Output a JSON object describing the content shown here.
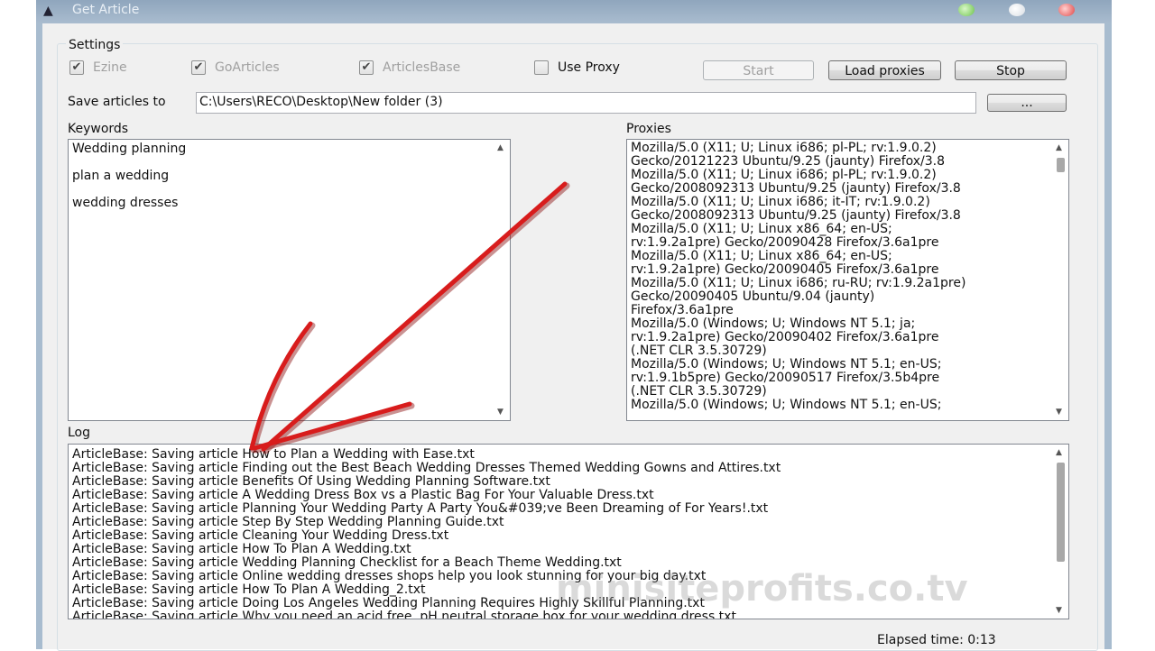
{
  "window": {
    "title": "Get Article"
  },
  "settings": {
    "group_label": "Settings",
    "checkboxes": [
      {
        "label": "Ezine",
        "checked": true,
        "enabled": false
      },
      {
        "label": "GoArticles",
        "checked": true,
        "enabled": false
      },
      {
        "label": "ArticlesBase",
        "checked": true,
        "enabled": false
      },
      {
        "label": "Use Proxy",
        "checked": false,
        "enabled": true
      }
    ],
    "buttons": {
      "start": "Start",
      "load_proxies": "Load proxies",
      "stop": "Stop",
      "browse": "..."
    },
    "save_label": "Save articles to",
    "save_path": "C:\\Users\\RECO\\Desktop\\New folder (3)"
  },
  "keywords": {
    "label": "Keywords",
    "items": [
      "Wedding planning",
      "plan a wedding",
      "wedding dresses"
    ]
  },
  "proxies": {
    "label": "Proxies",
    "lines": [
      "Mozilla/5.0 (X11; U; Linux i686; pl-PL; rv:1.9.0.2)",
      "Gecko/20121223 Ubuntu/9.25 (jaunty) Firefox/3.8",
      "Mozilla/5.0 (X11; U; Linux i686; pl-PL; rv:1.9.0.2)",
      "Gecko/2008092313 Ubuntu/9.25 (jaunty) Firefox/3.8",
      "Mozilla/5.0 (X11; U; Linux i686; it-IT; rv:1.9.0.2)",
      "Gecko/2008092313 Ubuntu/9.25 (jaunty) Firefox/3.8",
      "Mozilla/5.0 (X11; U; Linux x86_64; en-US;",
      "rv:1.9.2a1pre) Gecko/20090428 Firefox/3.6a1pre",
      "Mozilla/5.0 (X11; U; Linux x86_64; en-US;",
      "rv:1.9.2a1pre) Gecko/20090405 Firefox/3.6a1pre",
      "Mozilla/5.0 (X11; U; Linux i686; ru-RU; rv:1.9.2a1pre)",
      "Gecko/20090405 Ubuntu/9.04 (jaunty)",
      "Firefox/3.6a1pre",
      "Mozilla/5.0 (Windows; U; Windows NT 5.1; ja;",
      "rv:1.9.2a1pre) Gecko/20090402 Firefox/3.6a1pre",
      "(.NET CLR 3.5.30729)",
      "Mozilla/5.0 (Windows; U; Windows NT 5.1; en-US;",
      "rv:1.9.1b5pre) Gecko/20090517 Firefox/3.5b4pre",
      "(.NET CLR 3.5.30729)",
      "Mozilla/5.0 (Windows; U; Windows NT 5.1; en-US;"
    ]
  },
  "log": {
    "label": "Log",
    "lines": [
      "ArticleBase: Saving article How to Plan a Wedding with Ease.txt",
      "ArticleBase: Saving article Finding out the Best Beach Wedding Dresses Themed Wedding Gowns and Attires.txt",
      "ArticleBase: Saving article Benefits Of Using Wedding Planning Software.txt",
      "ArticleBase: Saving article A Wedding Dress Box vs a Plastic Bag For Your Valuable Dress.txt",
      "ArticleBase: Saving article Planning Your Wedding Party A Party You&#039;ve Been Dreaming of For Years!.txt",
      "ArticleBase: Saving article Step By Step Wedding Planning Guide.txt",
      "ArticleBase: Saving article Cleaning Your Wedding Dress.txt",
      "ArticleBase: Saving article How To Plan A Wedding.txt",
      "ArticleBase: Saving article Wedding Planning Checklist for a Beach Theme Wedding.txt",
      "ArticleBase: Saving article Online wedding dresses shops help you look stunning for your big day.txt",
      "ArticleBase: Saving article How To Plan A Wedding_2.txt",
      "ArticleBase: Saving article Doing Los Angeles Wedding Planning Requires Highly Skillful Planning.txt",
      "ArticleBase: Saving article Why you need an acid free, pH neutral storage box for your wedding dress.txt"
    ]
  },
  "status": {
    "elapsed": "Elapsed time: 0:13"
  },
  "watermark": "minisiteprofits.co.tv",
  "colors": {
    "annotation_arrow": "#d81c1c",
    "title_bar": "#9db2c7"
  }
}
